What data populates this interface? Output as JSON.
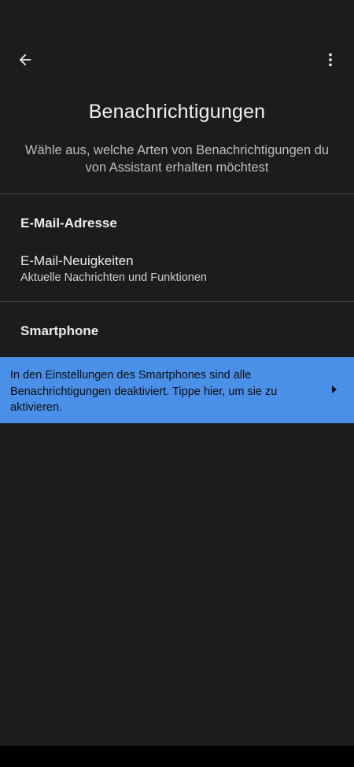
{
  "header": {
    "back_icon": "arrow-left-icon",
    "more_icon": "more-vertical-icon",
    "title": "Benachrichtigungen",
    "subtitle": "Wähle aus, welche Arten von Benachrichtigungen du von Assistant erhalten möchtest"
  },
  "sections": [
    {
      "header": "E-Mail-Adresse",
      "items": [
        {
          "title": "E-Mail-Neuigkeiten",
          "subtitle": "Aktuelle Nachrichten und Funktionen"
        }
      ]
    },
    {
      "header": "Smartphone"
    }
  ],
  "banner": {
    "text": "In den Einstellungen des Smartphones sind alle Benachrichtigungen deaktiviert. Tippe hier, um sie zu aktivieren.",
    "icon": "play-arrow-right-icon",
    "color": "#4a90e8"
  }
}
